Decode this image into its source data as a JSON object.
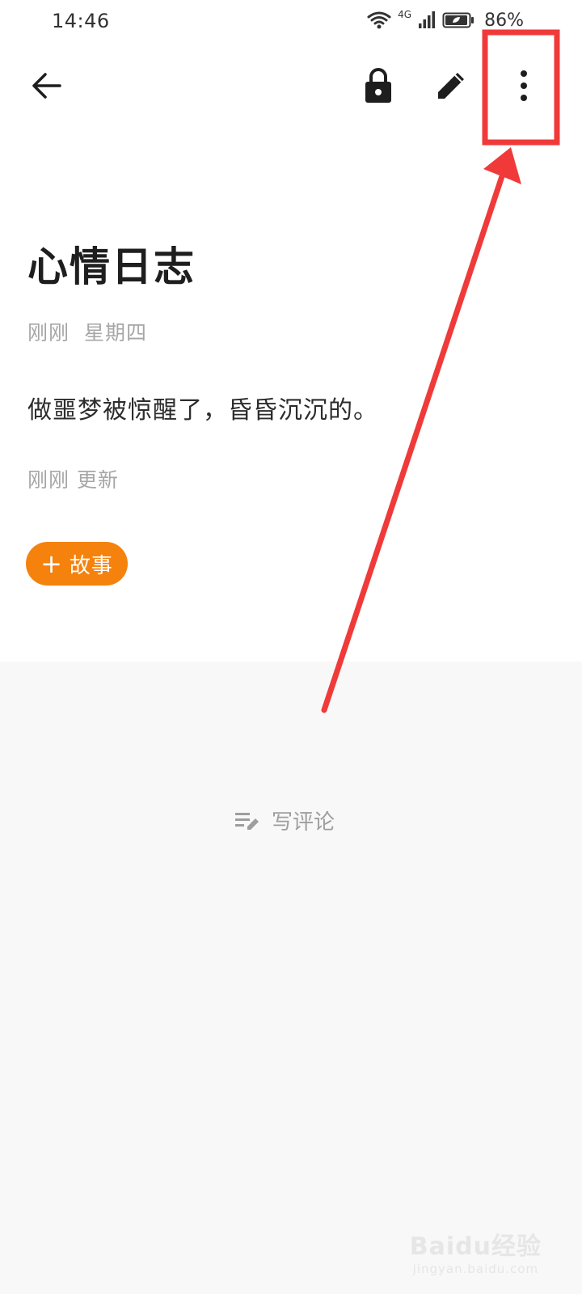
{
  "status_bar": {
    "time": "14:46",
    "network": "4G",
    "battery": "86%"
  },
  "toolbar": {
    "back_icon": "arrow-left-icon",
    "lock_icon": "lock-icon",
    "edit_icon": "pencil-icon",
    "more_icon": "more-vertical-icon"
  },
  "entry": {
    "title": "心情日志",
    "meta_time": "刚刚",
    "meta_weekday": "星期四",
    "body": "做噩梦被惊醒了，昏昏沉沉的。",
    "updated": "刚刚 更新"
  },
  "story_button": {
    "plus": "+",
    "label": "故事"
  },
  "comment": {
    "label": "写评论",
    "icon": "write-comment-icon"
  },
  "watermark": {
    "main": "Baidu经验",
    "sub": "jingyan.baidu.com"
  },
  "colors": {
    "accent": "#f5820d",
    "annotation": "#f03a3a",
    "comment_bg": "#f8f8f8"
  }
}
